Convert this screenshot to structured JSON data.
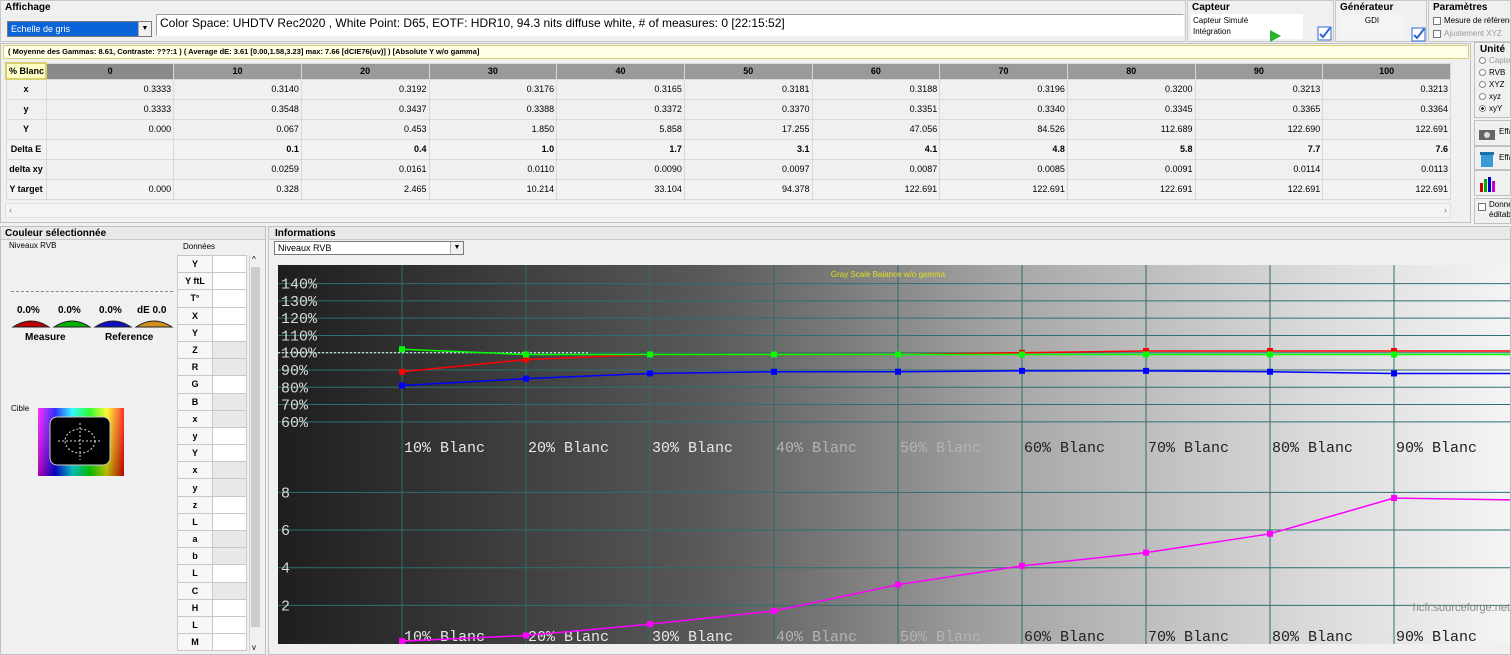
{
  "affichage": {
    "title": "Affichage",
    "mode": "Echelle de gris",
    "status": "Color Space: UHDTV Rec2020 , White Point: D65, EOTF:  HDR10, 94.3 nits diffuse white, # of measures: 0 [22:15:52]"
  },
  "capteur": {
    "title": "Capteur",
    "items": [
      "Capteur Simulé",
      "Intégration"
    ]
  },
  "generateur": {
    "title": "Générateur",
    "value": "GDI"
  },
  "parametres": {
    "title": "Paramètres",
    "items": [
      "Mesure de référence",
      "Ajustement XYZ"
    ]
  },
  "summary": "( Moyenne des Gammas: 8.61, Contraste: ???:1 ) ( Average dE: 3.61 [0.00,1.58,3.23] max: 7.66 [dCIE76(uv)] ) [Absolute Y w/o gamma]",
  "table": {
    "corner": "% Blanc",
    "columns": [
      "0",
      "10",
      "20",
      "30",
      "40",
      "50",
      "60",
      "70",
      "80",
      "90",
      "100"
    ],
    "rows": [
      {
        "label": "x",
        "values": [
          "0.3333",
          "0.3140",
          "0.3192",
          "0.3176",
          "0.3165",
          "0.3181",
          "0.3188",
          "0.3196",
          "0.3200",
          "0.3213",
          "0.3213"
        ]
      },
      {
        "label": "y",
        "values": [
          "0.3333",
          "0.3548",
          "0.3437",
          "0.3388",
          "0.3372",
          "0.3370",
          "0.3351",
          "0.3340",
          "0.3345",
          "0.3365",
          "0.3364"
        ]
      },
      {
        "label": "Y",
        "values": [
          "0.000",
          "0.067",
          "0.453",
          "1.850",
          "5.858",
          "17.255",
          "47.056",
          "84.526",
          "112.689",
          "122.690",
          "122.691"
        ]
      },
      {
        "label": "Delta E",
        "values": [
          "",
          "0.1",
          "0.4",
          "1.0",
          "1.7",
          "3.1",
          "4.1",
          "4.8",
          "5.8",
          "7.7",
          "7.6"
        ]
      },
      {
        "label": "delta xy",
        "values": [
          "",
          "0.0259",
          "0.0161",
          "0.0110",
          "0.0090",
          "0.0097",
          "0.0087",
          "0.0085",
          "0.0091",
          "0.0114",
          "0.0113"
        ]
      },
      {
        "label": "Y target",
        "values": [
          "0.000",
          "0.328",
          "2.465",
          "10.214",
          "33.104",
          "94.378",
          "122.691",
          "122.691",
          "122.691",
          "122.691",
          "122.691"
        ]
      }
    ]
  },
  "unite": {
    "title": "Unité",
    "options": [
      "Capteur",
      "RVB",
      "XYZ",
      "xyz",
      "xyY"
    ],
    "selected": "xyY"
  },
  "side": {
    "effacer": "Effacer",
    "donnees": "Données éditables"
  },
  "couleur": {
    "title": "Couleur sélectionnée",
    "niveaux": "Niveaux RVB",
    "donnees": "Données",
    "gauges": [
      "0.0%",
      "0.0%",
      "0.0%",
      "dE 0.0"
    ],
    "measure": "Measure",
    "reference": "Reference",
    "cible": "Cible",
    "data_keys": [
      "Y",
      "Y ftL",
      "T°",
      "X",
      "Y",
      "Z",
      "R",
      "G",
      "B",
      "x",
      "y",
      "Y",
      "x",
      "y",
      "z",
      "L",
      "a",
      "b",
      "L",
      "C",
      "H",
      "L",
      "M"
    ]
  },
  "informations": {
    "title": "Informations",
    "dropdown": "Niveaux RVB",
    "watermark": "hcfr.sourceforge.net"
  },
  "colors": {
    "red": "#ff0000",
    "green": "#00ff00",
    "blue": "#0000ff",
    "magenta": "#ff00ff",
    "chart_title": "#e0e020",
    "good": "#b2f2a8",
    "bad": "#fbb2b2"
  },
  "chart_data": [
    {
      "type": "line",
      "title": "Gray Scale Balance w/o gamma",
      "x": [
        10,
        20,
        30,
        40,
        50,
        60,
        70,
        80,
        90,
        100
      ],
      "x_tick_labels": [
        "10% Blanc",
        "20% Blanc",
        "30% Blanc",
        "40% Blanc",
        "50% Blanc",
        "60% Blanc",
        "70% Blanc",
        "80% Blanc",
        "90% Blanc"
      ],
      "y_tick_labels": [
        "60%",
        "70%",
        "80%",
        "90%",
        "100%",
        "110%",
        "120%",
        "130%",
        "140%"
      ],
      "ylim": [
        55,
        145
      ],
      "reference": 100,
      "series": [
        {
          "color": "red",
          "values": [
            89,
            96,
            99,
            99,
            99,
            100,
            101,
            101,
            101,
            101
          ]
        },
        {
          "color": "green",
          "values": [
            102,
            99,
            99,
            99,
            99,
            99,
            99,
            99,
            99,
            99
          ]
        },
        {
          "color": "blue",
          "values": [
            81,
            85,
            88,
            89,
            89,
            89.5,
            89.5,
            89,
            88,
            88
          ]
        }
      ]
    },
    {
      "type": "line",
      "x": [
        10,
        20,
        30,
        40,
        50,
        60,
        70,
        80,
        90,
        100
      ],
      "x_tick_labels": [
        "10% Blanc",
        "20% Blanc",
        "30% Blanc",
        "40% Blanc",
        "50% Blanc",
        "60% Blanc",
        "70% Blanc",
        "80% Blanc",
        "90% Blanc"
      ],
      "y_tick_labels": [
        "2",
        "4",
        "6",
        "8"
      ],
      "ylim": [
        0,
        8.5
      ],
      "series": [
        {
          "color": "magenta",
          "values": [
            0.1,
            0.4,
            1.0,
            1.7,
            3.1,
            4.1,
            4.8,
            5.8,
            7.7,
            7.6
          ]
        }
      ]
    }
  ]
}
